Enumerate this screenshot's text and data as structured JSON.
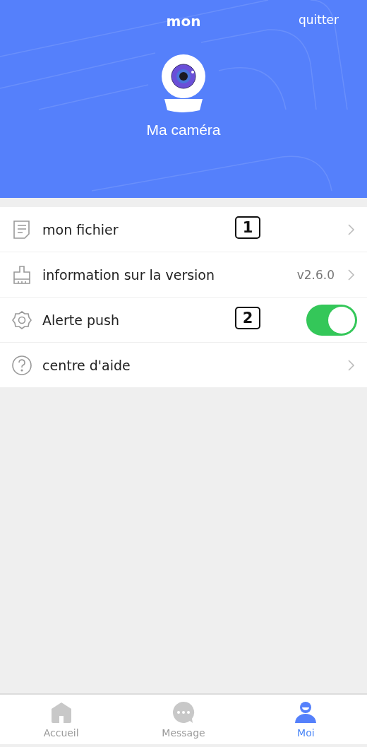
{
  "header": {
    "title": "mon",
    "action": "quitter",
    "device_name": "Ma caméra"
  },
  "menu": [
    {
      "kind": "link",
      "label": "mon fichier",
      "marker": "1"
    },
    {
      "kind": "link",
      "label": "information sur la version",
      "value": "v2.6.0"
    },
    {
      "kind": "toggle",
      "label": "Alerte push",
      "marker": "2",
      "on": true
    },
    {
      "kind": "link",
      "label": "centre d'aide"
    }
  ],
  "tabbar": [
    {
      "label": "Accueil",
      "selected": false
    },
    {
      "label": "Message",
      "selected": false
    },
    {
      "label": "Moi",
      "selected": true
    }
  ]
}
